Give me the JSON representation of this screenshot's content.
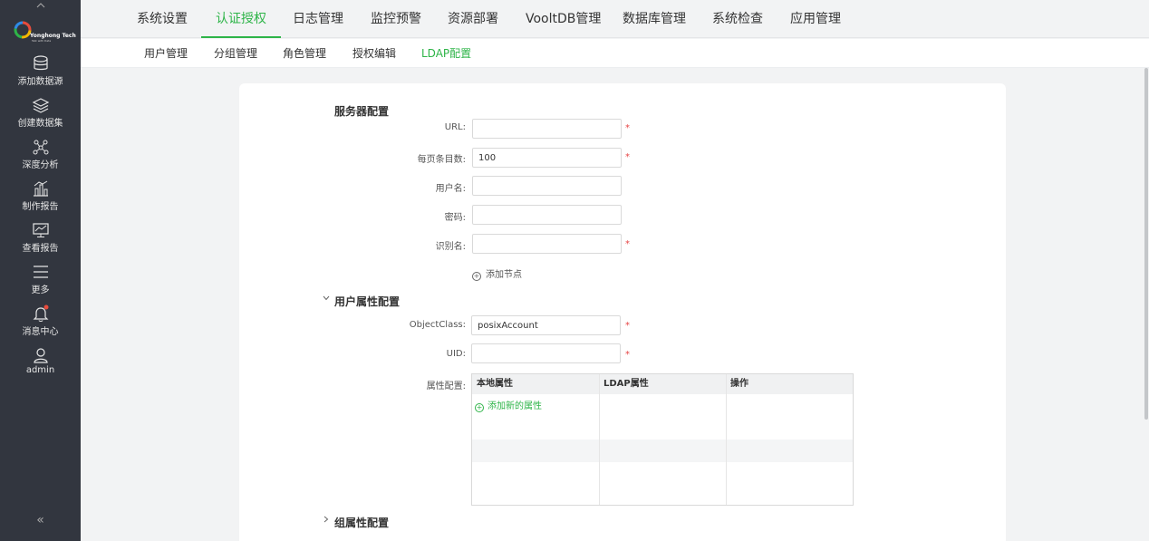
{
  "sidebar": {
    "logo": {
      "name": "Yonghong Tech",
      "tagline": "Talk with Data"
    },
    "items": [
      {
        "label": "添加数据源",
        "icon": "database-icon"
      },
      {
        "label": "创建数据集",
        "icon": "layers-icon"
      },
      {
        "label": "深度分析",
        "icon": "network-icon"
      },
      {
        "label": "制作报告",
        "icon": "bar-chart-icon"
      },
      {
        "label": "查看报告",
        "icon": "monitor-chart-icon"
      },
      {
        "label": "更多",
        "icon": "menu-icon"
      },
      {
        "label": "消息中心",
        "icon": "bell-icon"
      },
      {
        "label": "admin",
        "icon": "user-icon"
      }
    ],
    "collapse_glyph": "«"
  },
  "topnav": {
    "tabs": [
      "系统设置",
      "认证授权",
      "日志管理",
      "监控预警",
      "资源部署",
      "VooltDB管理",
      "数据库管理",
      "系统检查",
      "应用管理"
    ],
    "active_index": 1
  },
  "subnav": {
    "tabs": [
      "用户管理",
      "分组管理",
      "角色管理",
      "授权编辑",
      "LDAP配置"
    ],
    "active_index": 4
  },
  "server_config": {
    "title": "服务器配置",
    "fields": [
      {
        "label": "URL:",
        "value": "",
        "required": true
      },
      {
        "label": "每页条目数:",
        "value": "100",
        "required": true
      },
      {
        "label": "用户名:",
        "value": "",
        "required": false
      },
      {
        "label": "密码:",
        "value": "",
        "required": false
      },
      {
        "label": "识别名:",
        "value": "",
        "required": true
      }
    ],
    "add_node_label": "添加节点"
  },
  "user_attr_config": {
    "title": "用户属性配置",
    "expanded": true,
    "fields": [
      {
        "label": "ObjectClass:",
        "value": "posixAccount",
        "required": true
      },
      {
        "label": "UID:",
        "value": "",
        "required": true
      }
    ],
    "attr_label": "属性配置:",
    "table_headers": [
      "本地属性",
      "LDAP属性",
      "操作"
    ],
    "add_attr_label": "添加新的属性"
  },
  "group_attr_config": {
    "title": "组属性配置",
    "expanded": false
  },
  "colors": {
    "accent": "#2eb448",
    "sidebar_bg": "#32363f",
    "required": "#e64545"
  }
}
